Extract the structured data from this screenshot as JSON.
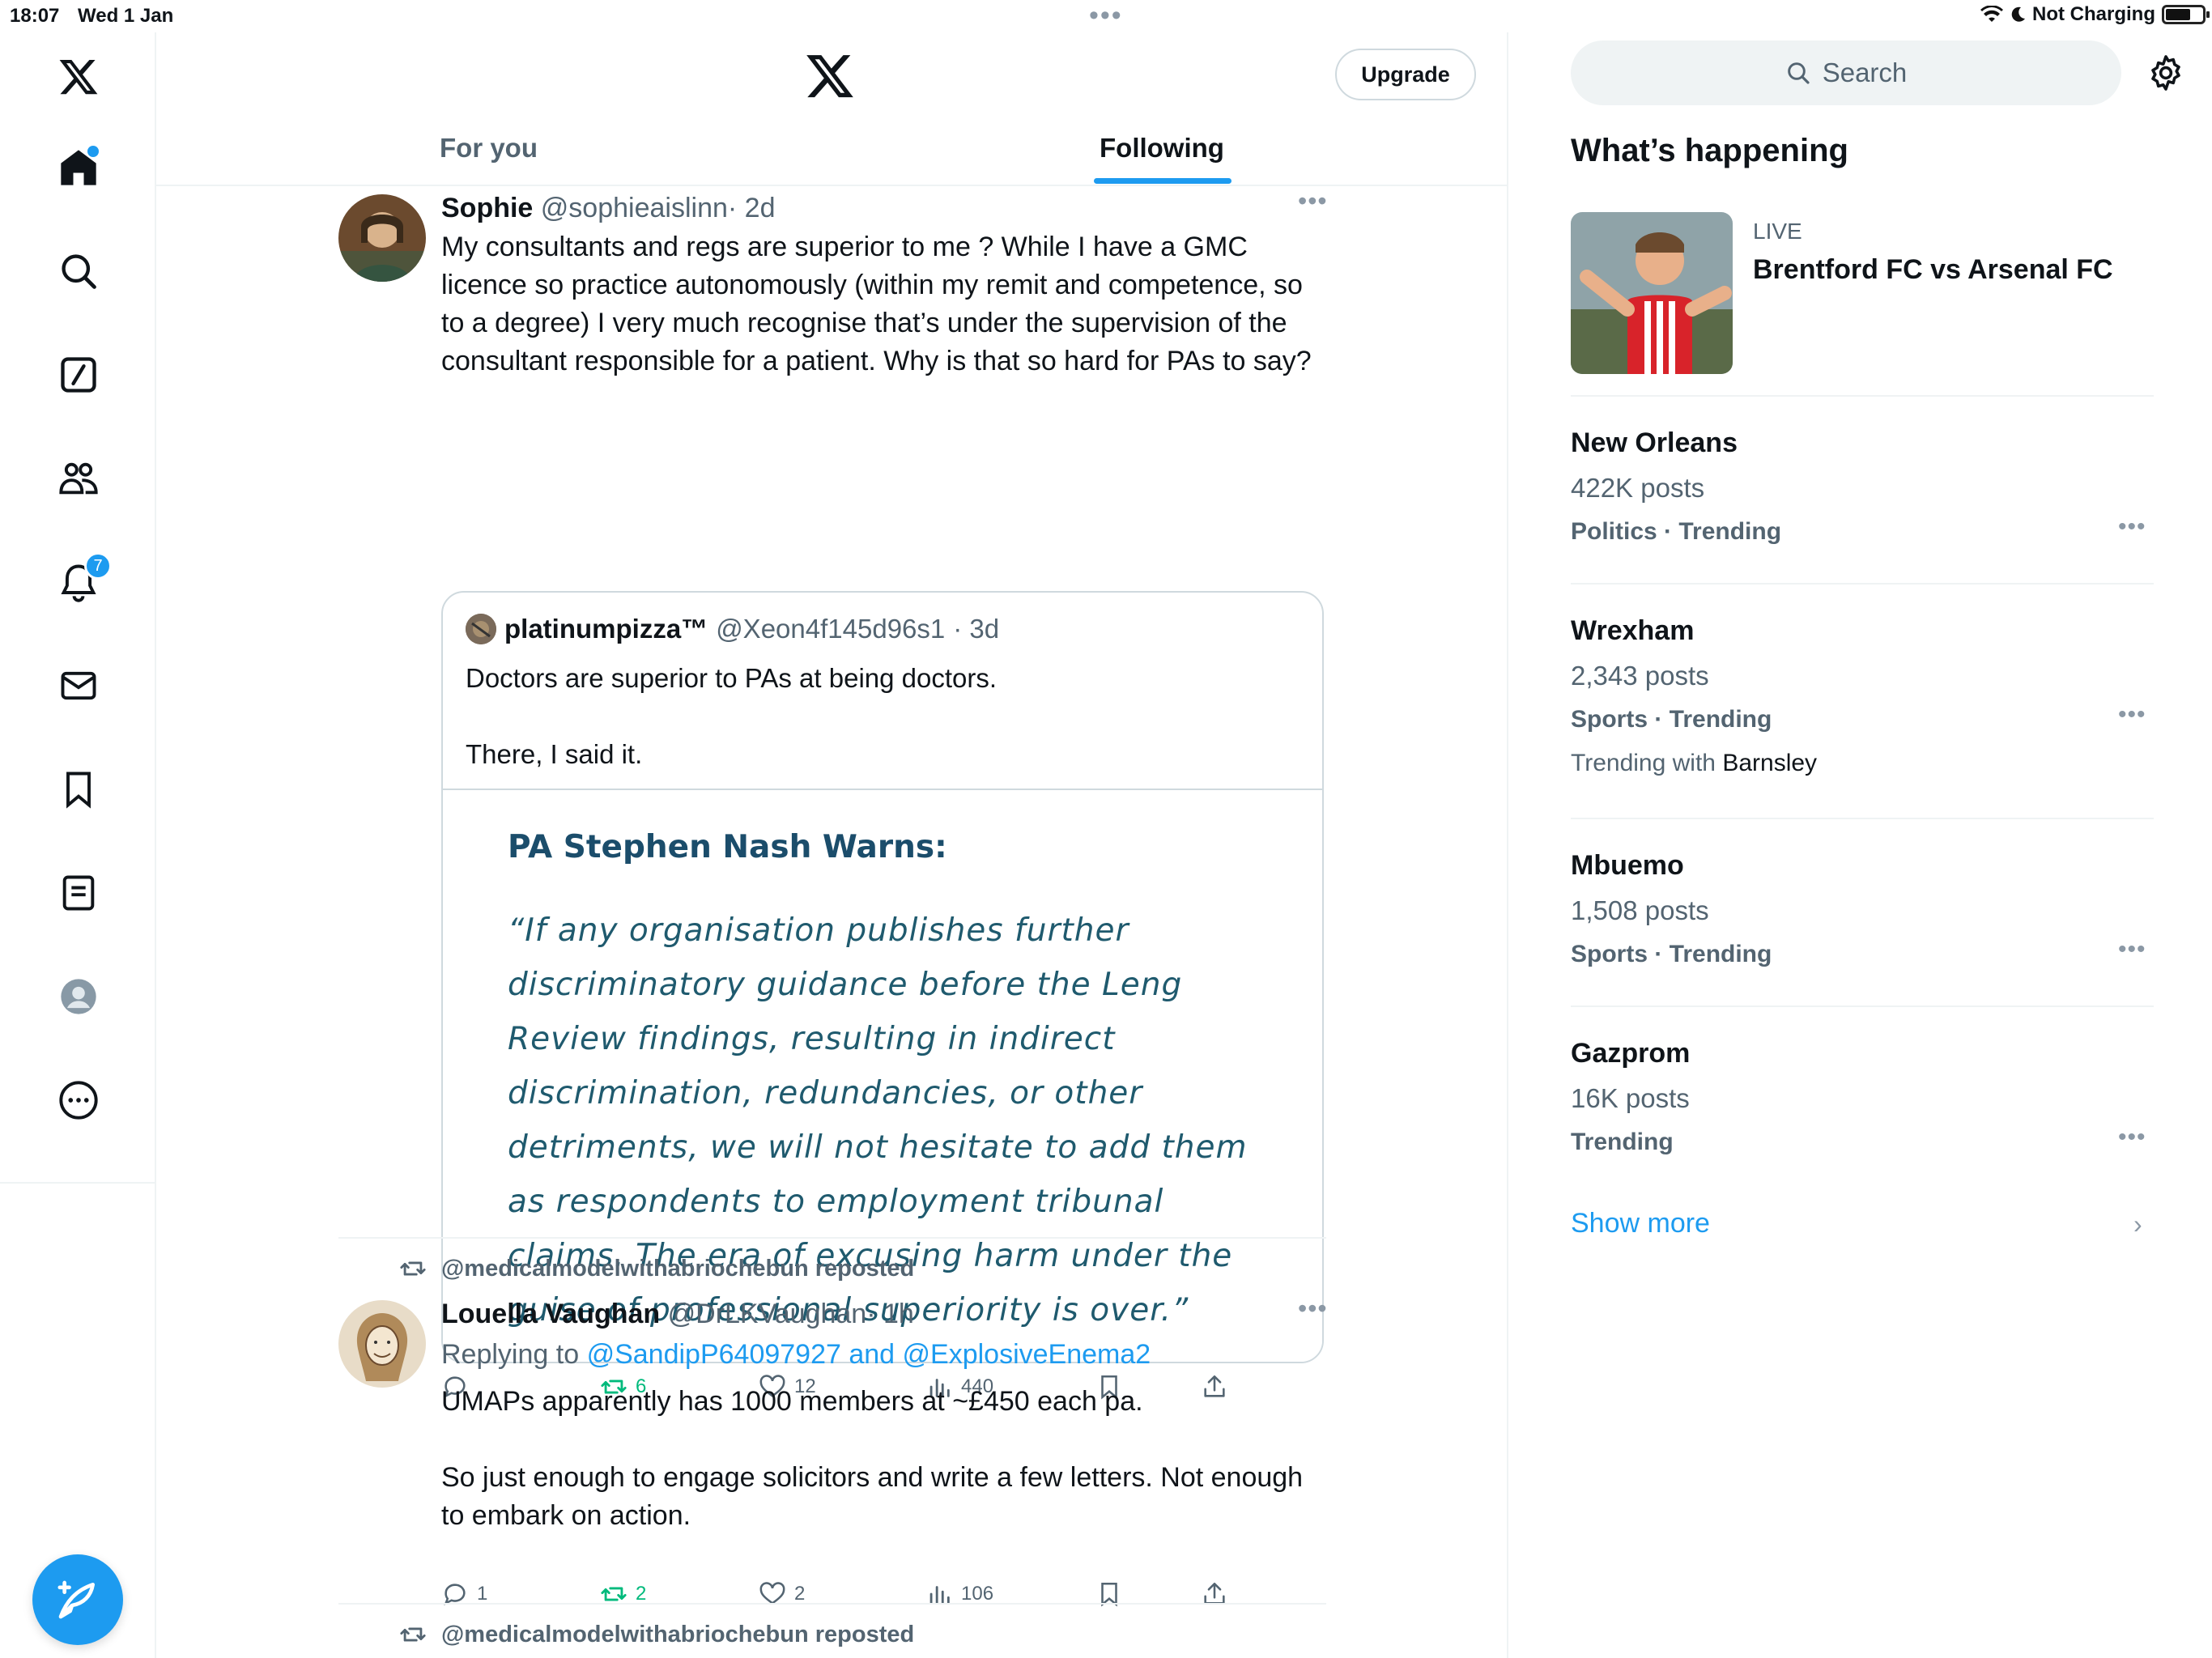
{
  "status": {
    "time": "18:07",
    "date": "Wed 1 Jan",
    "charging": "Not Charging",
    "dots": "•••"
  },
  "nav": {
    "notifications_count": "7"
  },
  "header": {
    "upgrade_label": "Upgrade"
  },
  "tabs": [
    {
      "label": "For you"
    },
    {
      "label": "Following"
    }
  ],
  "posts": [
    {
      "name": "Sophie",
      "handle": "@sophieaislinn",
      "time": "· 2d",
      "text": "My consultants and regs are superior to me ? While I have a GMC licence so practice autonomously (within my remit and competence, so to a degree) I very much recognise that’s under the supervision of the consultant responsible for a patient. Why is that so hard for PAs to say?",
      "quote": {
        "name": "platinumpizza™",
        "handle": "@Xeon4f145d96s1",
        "time": "· 3d",
        "line1": "Doctors are superior to PAs at being doctors.",
        "line2": "There, I said it.",
        "media_title": "PA Stephen Nash Warns:",
        "media_quote": "“If any organisation publishes further discriminatory guidance before the Leng Review findings, resulting in indirect discrimination, redundancies, or other detriments, we will not hesitate to add them as respondents to employment tribunal claims. The era of excusing harm under the guise of professional superiority is over.”"
      },
      "stats": {
        "replies": "",
        "reposts": "6",
        "likes": "12",
        "views": "440"
      }
    },
    {
      "reposted_by": "@medicalmodelwithabriochebun reposted",
      "name": "Louella Vaughan",
      "handle": "@DrLKVaughan",
      "time": "· 1h",
      "replying_prefix": "Replying to",
      "replying_to": "@SandipP64097927 and @ExplosiveEnema2",
      "text1": "UMAPs apparently has 1000 members at ~£450 each pa.",
      "text2": "So just enough to engage solicitors and write a few letters. Not enough to embark on action.",
      "stats": {
        "replies": "1",
        "reposts": "2",
        "likes": "2",
        "views": "106"
      }
    },
    {
      "reposted_by": "@medicalmodelwithabriochebun reposted"
    }
  ],
  "sidebar": {
    "search_placeholder": "Search",
    "section_title": "What’s happening",
    "live": {
      "label": "LIVE",
      "title": "Brentford FC vs Arsenal FC"
    },
    "trends": [
      {
        "name": "New Orleans",
        "posts": "422K posts",
        "category": "Politics · Trending"
      },
      {
        "name": "Wrexham",
        "posts": "2,343 posts",
        "category": "Sports · Trending",
        "with_prefix": "Trending with",
        "with": "Barnsley"
      },
      {
        "name": "Mbuemo",
        "posts": "1,508 posts",
        "category": "Sports · Trending"
      },
      {
        "name": "Gazprom",
        "posts": "16K posts",
        "category": "Trending"
      }
    ],
    "show_more": "Show more"
  },
  "colors": {
    "accent": "#1d9bf0",
    "repost_green": "#00ba7c",
    "muted": "#536471"
  },
  "icons": [
    "x-logo-icon",
    "home-icon",
    "search-icon",
    "grok-icon",
    "communities-icon",
    "bell-icon",
    "mail-icon",
    "bookmark-icon",
    "lists-icon",
    "profile-icon",
    "more-icon",
    "compose-icon",
    "gear-icon",
    "reply-icon",
    "repost-icon",
    "heart-icon",
    "views-icon",
    "share-icon"
  ]
}
